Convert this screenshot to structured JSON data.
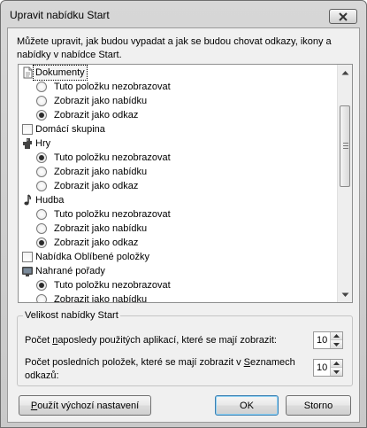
{
  "dialog": {
    "title": "Upravit nabídku Start",
    "intro_line1": "Můžete upravit, jak budou vypadat a jak se budou chovat odkazy, ikony a",
    "intro_line2": "nabídky v nabídce Start."
  },
  "list": {
    "items": [
      {
        "kind": "category",
        "icon": "document-icon",
        "label": "Dokumenty",
        "focused": true
      },
      {
        "kind": "option",
        "label": "Tuto položku nezobrazovat",
        "checked": false
      },
      {
        "kind": "option",
        "label": "Zobrazit jako nabídku",
        "checked": false
      },
      {
        "kind": "option",
        "label": "Zobrazit jako odkaz",
        "checked": true
      },
      {
        "kind": "checkbox",
        "label": "Domácí skupina",
        "checked": false
      },
      {
        "kind": "category",
        "icon": "games-icon",
        "label": "Hry"
      },
      {
        "kind": "option",
        "label": "Tuto položku nezobrazovat",
        "checked": true
      },
      {
        "kind": "option",
        "label": "Zobrazit jako nabídku",
        "checked": false
      },
      {
        "kind": "option",
        "label": "Zobrazit jako odkaz",
        "checked": false
      },
      {
        "kind": "category",
        "icon": "music-note-icon",
        "label": "Hudba"
      },
      {
        "kind": "option",
        "label": "Tuto položku nezobrazovat",
        "checked": false
      },
      {
        "kind": "option",
        "label": "Zobrazit jako nabídku",
        "checked": false
      },
      {
        "kind": "option",
        "label": "Zobrazit jako odkaz",
        "checked": true
      },
      {
        "kind": "checkbox",
        "label": "Nabídka Oblíbené položky",
        "checked": false
      },
      {
        "kind": "category",
        "icon": "recorded-tv-icon",
        "label": "Nahrané pořady"
      },
      {
        "kind": "option",
        "label": "Tuto položku nezobrazovat",
        "checked": true
      },
      {
        "kind": "option",
        "label": "Zobrazit jako nabídku",
        "checked": false
      }
    ]
  },
  "size_group": {
    "title": "Velikost nabídky Start",
    "recent_apps": {
      "label_before": "Počet ",
      "label_accel": "n",
      "label_after": "aposledy použitých aplikací, které se mají zobrazit:",
      "value": "10"
    },
    "recent_items": {
      "label_line1_before": "Počet posledních položek, které se mají zobrazit v ",
      "label_line1_accel": "S",
      "label_line1_after": "eznamech",
      "label_line2": "odkazů:",
      "value": "10"
    }
  },
  "buttons": {
    "reset_accel": "P",
    "reset_rest": "oužít výchozí nastavení",
    "ok": "OK",
    "cancel": "Storno"
  }
}
